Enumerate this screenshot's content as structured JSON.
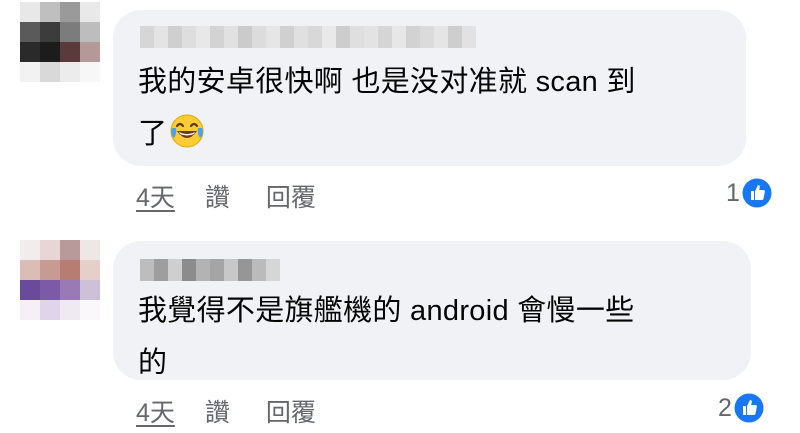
{
  "comments": [
    {
      "text_line1": "我的安卓很快啊 也是没对准就 scan 到",
      "text_line2": "了",
      "emoji": "face-with-tears-of-joy",
      "time": "4天",
      "like_label": "讚",
      "reply_label": "回覆",
      "reaction_count": "1",
      "reaction_icon": "thumbs-up-icon",
      "avatar_colors": [
        "#e8e8e8",
        "#bfbfbf",
        "#9a9a9a",
        "#e9e9e9",
        "#5a5a5a",
        "#3c3c3c",
        "#7c7c7c",
        "#bdbdbd",
        "#2a2a2a",
        "#1c1c1c",
        "#5a3a3a",
        "#b59999",
        "#f2f2f2",
        "#d9d9d9",
        "#ececec",
        "#f7f7f7"
      ]
    },
    {
      "text_line1": "我覺得不是旗艦機的 android 會慢一些",
      "text_line2": "的",
      "time": "4天",
      "like_label": "讚",
      "reply_label": "回覆",
      "reaction_count": "2",
      "reaction_icon": "thumbs-up-icon",
      "avatar_colors": [
        "#f3ecec",
        "#e8d6d6",
        "#b99a9a",
        "#efe6e6",
        "#d9bdb6",
        "#c69b93",
        "#b87d72",
        "#e5cfc9",
        "#6a4a9a",
        "#7b5aa8",
        "#9a7ab5",
        "#cfc0d9",
        "#f4f0f6",
        "#e0d4e8",
        "#efe9f2",
        "#faf8fb"
      ]
    }
  ],
  "colors": {
    "bubble": "#f0f2f5",
    "text": "#050505",
    "meta": "#65676b",
    "like_blue": "#1877f2"
  }
}
